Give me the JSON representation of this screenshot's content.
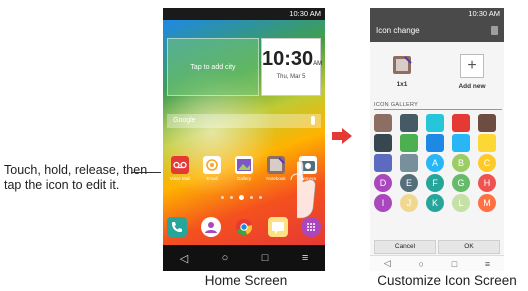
{
  "callout": {
    "text": "Touch, hold, release, then tap the icon to edit it."
  },
  "captions": {
    "home": "Home Screen",
    "customize": "Customize Icon Screen"
  },
  "home_screen": {
    "status_time": "10:30 AM",
    "weather_prompt": "Tap to add city",
    "clock": {
      "time": "10:30",
      "ampm": "AM",
      "date": "Thu, Mar 5"
    },
    "search_label": "Google",
    "apps": [
      {
        "label": "Voice Mail",
        "color": "#e53935"
      },
      {
        "label": "Email",
        "color": "#fbc02d"
      },
      {
        "label": "Gallery",
        "color": "#7e57c2"
      },
      {
        "label": "Notebook",
        "color": "#8d6e63"
      },
      {
        "label": "Camera",
        "color": "#607d8b"
      }
    ],
    "dock": [
      {
        "name": "phone",
        "color": "#26a69a"
      },
      {
        "name": "contacts",
        "color": "#ffffff"
      },
      {
        "name": "chrome",
        "color": "#fbc02d"
      },
      {
        "name": "messaging",
        "color": "#ffe082"
      },
      {
        "name": "apps",
        "color": "#ab47bc"
      }
    ],
    "nav": [
      "◁",
      "○",
      "□",
      "≡"
    ]
  },
  "icon_change": {
    "status_time": "10:30 AM",
    "title": "Icon change",
    "current_label": "1x1",
    "add_label": "Add new",
    "gallery_heading": "ICON GALLERY",
    "gallery": [
      {
        "type": "img",
        "color": "#8d6e63"
      },
      {
        "type": "img",
        "color": "#455a64"
      },
      {
        "type": "img",
        "color": "#26c6da"
      },
      {
        "type": "img",
        "color": "#e53935"
      },
      {
        "type": "img",
        "color": "#6d4c41"
      },
      {
        "type": "img",
        "color": "#37474f"
      },
      {
        "type": "img",
        "color": "#4caf50"
      },
      {
        "type": "img",
        "color": "#1e88e5"
      },
      {
        "type": "img",
        "color": "#29b6f6"
      },
      {
        "type": "img",
        "color": "#fdd835"
      },
      {
        "type": "img",
        "color": "#5c6bc0"
      },
      {
        "type": "img",
        "color": "#78909c"
      },
      {
        "type": "letter",
        "text": "A",
        "color": "#29b6f6"
      },
      {
        "type": "letter",
        "text": "B",
        "color": "#9ccc65"
      },
      {
        "type": "letter",
        "text": "C",
        "color": "#ffca28"
      },
      {
        "type": "letter",
        "text": "D",
        "color": "#ab47bc"
      },
      {
        "type": "letter",
        "text": "E",
        "color": "#546e7a"
      },
      {
        "type": "letter",
        "text": "F",
        "color": "#26a69a"
      },
      {
        "type": "letter",
        "text": "G",
        "color": "#66bb6a"
      },
      {
        "type": "letter",
        "text": "H",
        "color": "#ef5350"
      },
      {
        "type": "letter",
        "text": "I",
        "color": "#ab47bc"
      },
      {
        "type": "letter",
        "text": "J",
        "color": "#f0d890"
      },
      {
        "type": "letter",
        "text": "K",
        "color": "#26a69a"
      },
      {
        "type": "letter",
        "text": "L",
        "color": "#c5e1a5"
      },
      {
        "type": "letter",
        "text": "M",
        "color": "#ff7043"
      }
    ],
    "cancel_label": "Cancel",
    "ok_label": "OK",
    "nav": [
      "◁",
      "○",
      "□",
      "≡"
    ]
  },
  "colors": {
    "arrow": "#e53935",
    "title_bar": "#4a4a4a",
    "gallery_rule": "#7b9bd1"
  }
}
